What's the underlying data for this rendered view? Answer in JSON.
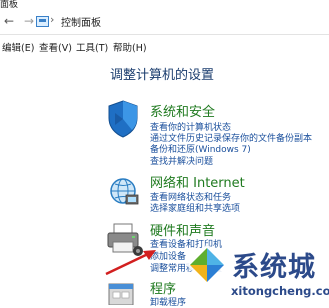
{
  "window": {
    "title_fragment": "面板"
  },
  "address_bar": {
    "location": "控制面板",
    "separator": "›"
  },
  "menubar": {
    "items": [
      "编辑(E)",
      "查看(V)",
      "工具(T)",
      "帮助(H)"
    ]
  },
  "main": {
    "heading": "调整计算机的设置",
    "categories": [
      {
        "title": "系统和安全",
        "icon": "shield-icon",
        "links": [
          "查看你的计算机状态",
          "通过文件历史记录保存你的文件备份副本",
          "备份和还原(Windows 7)",
          "查找并解决问题"
        ]
      },
      {
        "title": "网络和 Internet",
        "icon": "globe-icon",
        "links": [
          "查看网络状态和任务",
          "选择家庭组和共享选项"
        ]
      },
      {
        "title": "硬件和声音",
        "icon": "printer-icon",
        "links": [
          "查看设备和打印机",
          "添加设备",
          "调整常用移动设置"
        ]
      },
      {
        "title": "程序",
        "icon": "programs-icon",
        "links": [
          "卸载程序"
        ]
      }
    ]
  },
  "watermark": {
    "text": "系统城",
    "sub": "xitongcheng.com",
    "colors": {
      "blue": "#2c4a8a",
      "green": "#5fae2e",
      "light_blue": "#4fb3e6"
    }
  },
  "colors": {
    "link": "#1a4f9c",
    "category": "#1f7a1f",
    "heading": "#1b3d6e",
    "arrow": "#d21f1f"
  }
}
